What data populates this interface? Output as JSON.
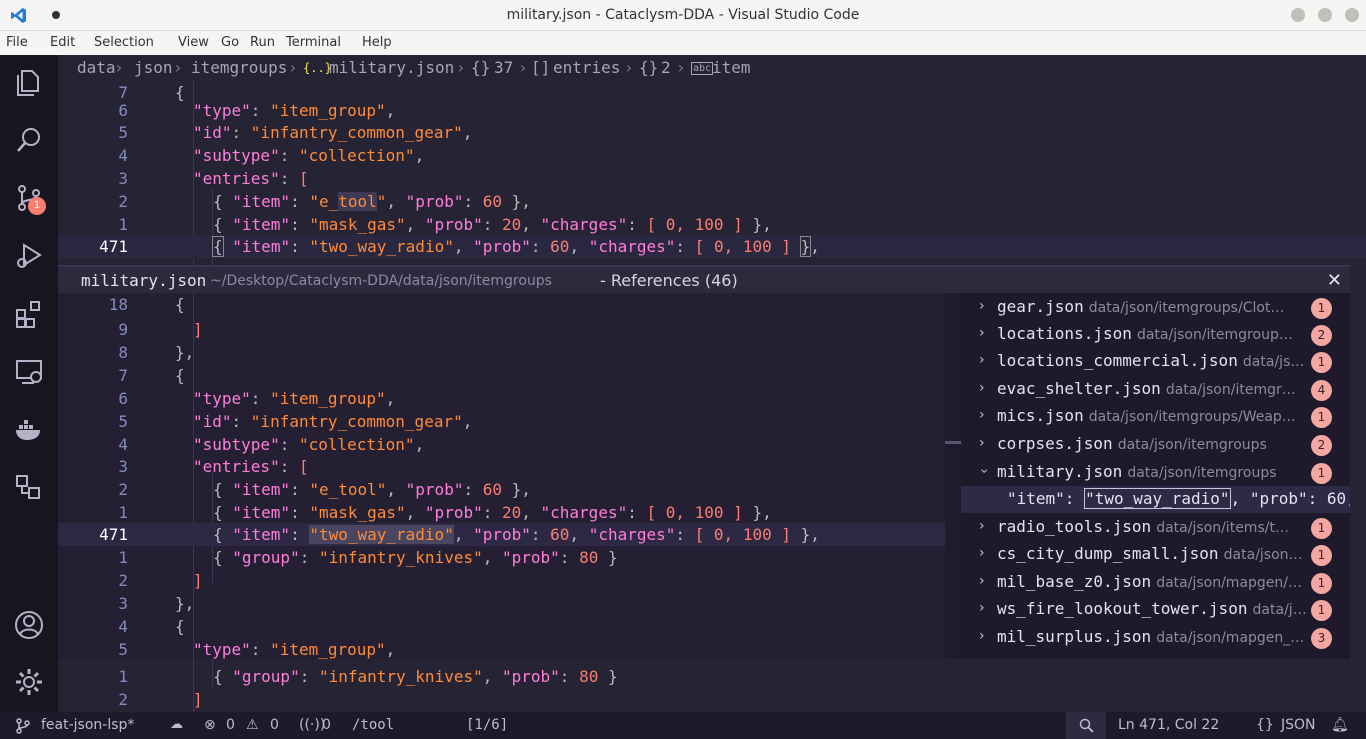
{
  "window": {
    "title": "military.json - Cataclysm-DDA - Visual Studio Code"
  },
  "menu": [
    "File",
    "Edit",
    "Selection",
    "View",
    "Go",
    "Run",
    "Terminal",
    "Help"
  ],
  "activity": {
    "scm_badge": "1"
  },
  "breadcrumb": {
    "parts": [
      "data",
      "json",
      "itemgroups",
      "military.json",
      "37",
      "entries",
      "2",
      "item"
    ]
  },
  "editor": {
    "line_numbers": [
      "7",
      "6",
      "5",
      "4",
      "3",
      "2",
      "1",
      "471"
    ],
    "cursor_line": "Ln 471, Col 22"
  },
  "peek": {
    "file": "military.json",
    "path": "~/Desktop/Cataclysm-DDA/data/json/itemgroups",
    "refs_label": "- References (46)",
    "line_numbers": [
      "18",
      "9",
      "8",
      "7",
      "6",
      "5",
      "4",
      "3",
      "2",
      "1",
      "471",
      "1",
      "2",
      "3",
      "4",
      "5"
    ],
    "references": [
      {
        "name": "gear.json",
        "path": "data/json/itemgroups/Clot…",
        "count": "1",
        "expanded": false
      },
      {
        "name": "locations.json",
        "path": "data/json/itemgroup…",
        "count": "2",
        "expanded": false
      },
      {
        "name": "locations_commercial.json",
        "path": "data/js…",
        "count": "1",
        "expanded": false
      },
      {
        "name": "evac_shelter.json",
        "path": "data/json/itemgr…",
        "count": "4",
        "expanded": false
      },
      {
        "name": "mics.json",
        "path": "data/json/itemgroups/Weap…",
        "count": "1",
        "expanded": false
      },
      {
        "name": "corpses.json",
        "path": "data/json/itemgroups",
        "count": "2",
        "expanded": false
      },
      {
        "name": "military.json",
        "path": "data/json/itemgroups",
        "count": "1",
        "expanded": true
      },
      {
        "name": "radio_tools.json",
        "path": "data/json/items/t…",
        "count": "1",
        "expanded": false
      },
      {
        "name": "cs_city_dump_small.json",
        "path": "data/json…",
        "count": "1",
        "expanded": false
      },
      {
        "name": "mil_base_z0.json",
        "path": "data/json/mapgen/…",
        "count": "1",
        "expanded": false
      },
      {
        "name": "ws_fire_lookout_tower.json",
        "path": "data/j…",
        "count": "1",
        "expanded": false
      },
      {
        "name": "mil_surplus.json",
        "path": "data/json/mapgen_…",
        "count": "3",
        "expanded": false
      }
    ],
    "ref_line": {
      "key": "\"item\"",
      "value": "\"two_way_radio\"",
      "rest": ", \"prob\": 60,"
    }
  },
  "bottom": {
    "line_numbers": [
      "1",
      "2"
    ]
  },
  "status": {
    "branch": "feat-json-lsp*",
    "errors": "0",
    "warnings": "0",
    "ports": "0",
    "command": "/tool",
    "match": "[1/6]",
    "position": "Ln 471, Col 22",
    "language": "JSON"
  },
  "colors": {
    "background": "#262335",
    "keyword": "#ff7edb",
    "string": "#ff8b39",
    "number": "#f97e72",
    "badge": "#f4a6a0"
  }
}
